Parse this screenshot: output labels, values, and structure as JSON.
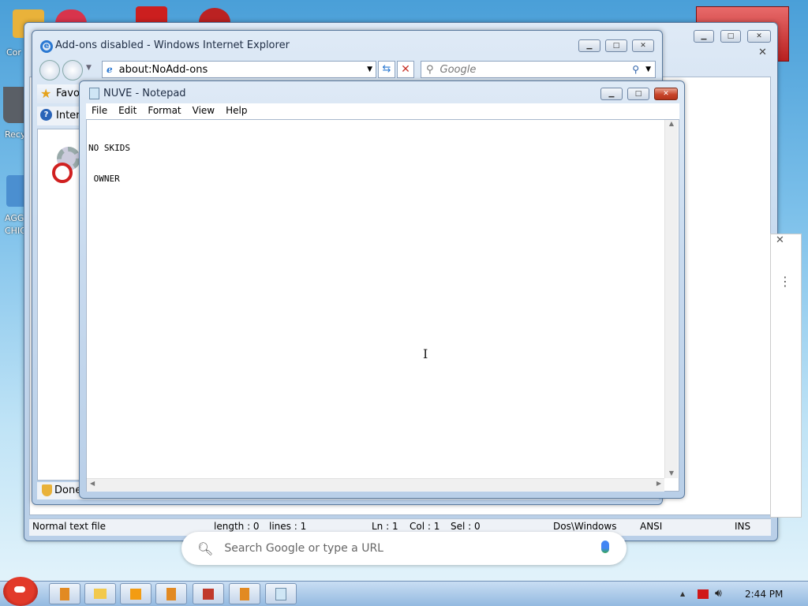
{
  "desktop": {
    "icons": [
      {
        "label": "Cor",
        "color": "#f2b233"
      },
      {
        "label": "Recy",
        "color": "#6a6f78"
      },
      {
        "label": "AGG",
        "label2": "CHIC",
        "color": "#4b8fd0"
      }
    ]
  },
  "ie_window": {
    "title": "Add-ons disabled - Windows Internet Explorer",
    "address": "about:NoAdd-ons",
    "search_placeholder": "Google",
    "favorites_label": "Favo",
    "info_label": "Interi",
    "status": "Done"
  },
  "chrome_window": {
    "search_placeholder": "Search Google or type a URL"
  },
  "notepad": {
    "title": "NUVE - Notepad",
    "menu": [
      "File",
      "Edit",
      "Format",
      "View",
      "Help"
    ],
    "content_line1": "NO SKIDS",
    "content_line2": " OWNER"
  },
  "outer_status": {
    "file_type": "Normal text file",
    "length": "length : 0",
    "lines": "lines : 1",
    "ln": "Ln : 1",
    "col": "Col : 1",
    "sel": "Sel : 0",
    "eol": "Dos\\Windows",
    "encoding": "ANSI",
    "mode": "INS"
  },
  "taskbar": {
    "clock": "2:44 PM",
    "buttons": [
      "app-1",
      "folder",
      "media-player",
      "app-2",
      "app-3",
      "app-4",
      "notepad"
    ]
  },
  "colors": {
    "accent_red": "#c8452b",
    "ie_blue": "#1a5fb4",
    "taskbar": "#9ec3e6"
  }
}
